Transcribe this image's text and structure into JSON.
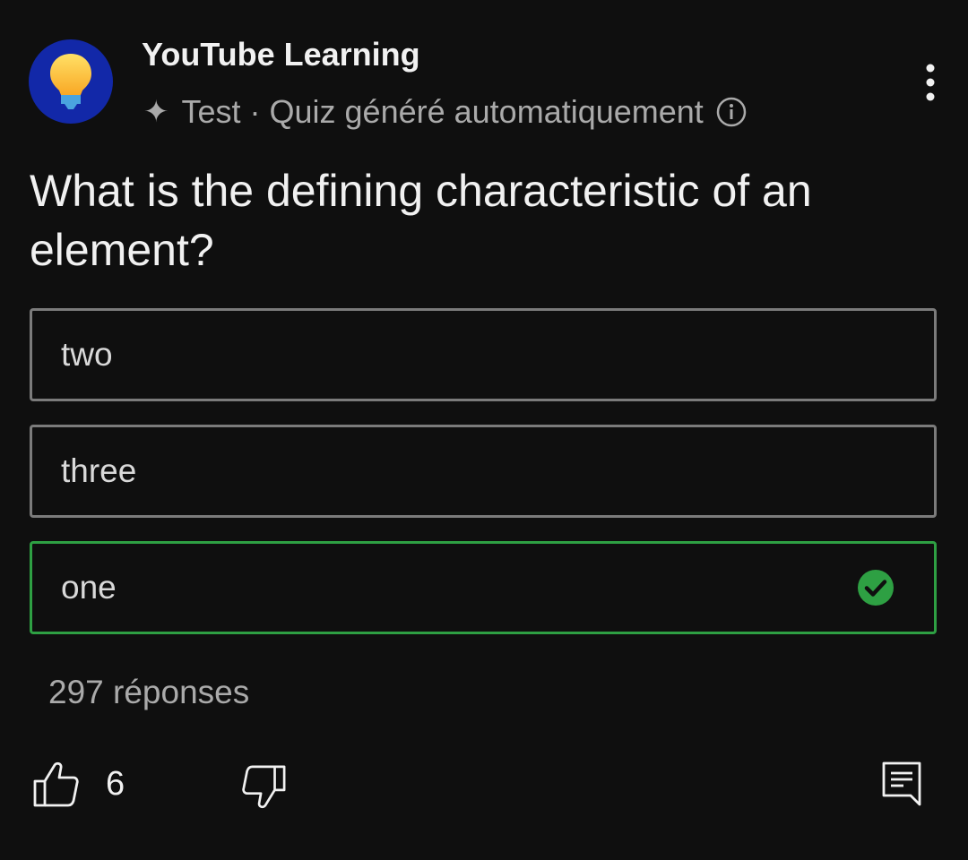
{
  "header": {
    "channel_name": "YouTube Learning",
    "avatar_icon": "lightbulb-icon",
    "sparkle_glyph": "✦",
    "subtitle": "Test · Quiz généré automatiquement",
    "info_icon": "info-icon",
    "more_icon": "vertical-dots-icon"
  },
  "quiz": {
    "question": "What is the defining characteristic of an element?",
    "options": [
      {
        "label": "two",
        "state": "unselected"
      },
      {
        "label": "three",
        "state": "unselected"
      },
      {
        "label": "one",
        "state": "correct"
      }
    ],
    "responses": "297 réponses"
  },
  "actions": {
    "like_count": "6",
    "like_icon": "thumbs-up-icon",
    "dislike_icon": "thumbs-down-icon",
    "comment_icon": "comment-icon"
  },
  "colors": {
    "background": "#0f0f0f",
    "avatar_bg": "#1228a8",
    "correct": "#2ea043",
    "option_border": "#7b7b7b"
  }
}
